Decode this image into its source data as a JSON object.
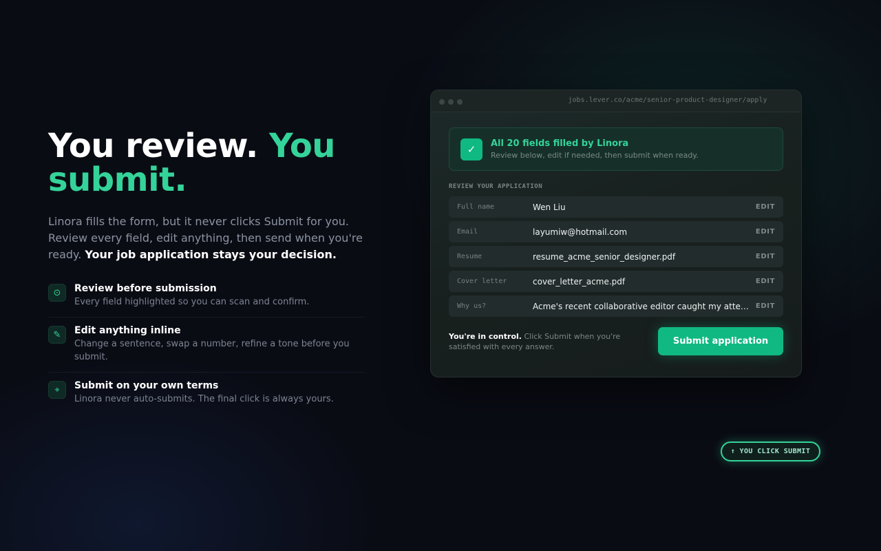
{
  "hero": {
    "headline_white": "You review.",
    "headline_accent_1": "You",
    "headline_accent_2": "submit.",
    "subtext": "Linora fills the form, but it never clicks Submit for you. Review every field, edit anything, then send when you're ready.",
    "subtext_bold": "Your job application stays your decision."
  },
  "features": [
    {
      "icon": "target-icon",
      "glyph": "⊙",
      "title": "Review before submission",
      "desc": "Every field highlighted so you can scan and confirm."
    },
    {
      "icon": "pencil-icon",
      "glyph": "✎",
      "title": "Edit anything inline",
      "desc": "Change a sentence, swap a number, refine a tone before you submit."
    },
    {
      "icon": "crosshair-icon",
      "glyph": "⌖",
      "title": "Submit on your own terms",
      "desc": "Linora never auto-submits. The final click is always yours."
    }
  ],
  "window": {
    "url": "jobs.lever.co/acme/senior-product-designer/apply",
    "banner": {
      "check_glyph": "✓",
      "title": "All 20 fields filled by Linora",
      "subtitle": "Review below, edit if needed, then submit when ready."
    },
    "section_label": "REVIEW YOUR APPLICATION",
    "rows": [
      {
        "label": "Full name",
        "value": "Wen Liu",
        "action": "EDIT"
      },
      {
        "label": "Email",
        "value": "layumiw@hotmail.com",
        "action": "EDIT"
      },
      {
        "label": "Resume",
        "value": "resume_acme_senior_designer.pdf",
        "action": "EDIT"
      },
      {
        "label": "Cover letter",
        "value": "cover_letter_acme.pdf",
        "action": "EDIT"
      },
      {
        "label": "Why us?",
        "value": "Acme's recent collaborative editor caught my attention",
        "action": "EDIT"
      }
    ],
    "control_bold": "You're in control.",
    "control_text": "Click Submit when you're satisfied with every answer.",
    "submit_label": "Submit application"
  },
  "pill_label": "↑ YOU CLICK SUBMIT",
  "colors": {
    "accent": "#34d399",
    "button": "#10b981",
    "background": "#0a0c14"
  }
}
